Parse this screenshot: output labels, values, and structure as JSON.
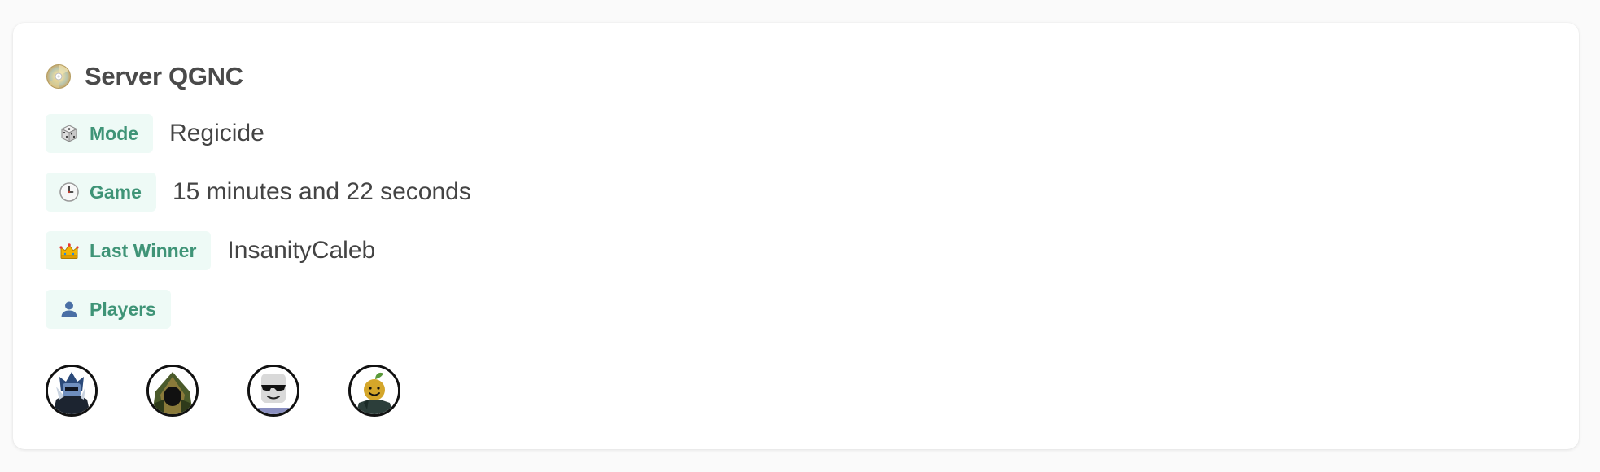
{
  "server": {
    "title": "Server QGNC",
    "icon": "disc-icon"
  },
  "fields": [
    {
      "label": "Mode",
      "icon": "die-icon",
      "value": "Regicide"
    },
    {
      "label": "Game",
      "icon": "clock-icon",
      "value": "15 minutes and 22 seconds"
    },
    {
      "label": "Last Winner",
      "icon": "crown-icon",
      "value": "InsanityCaleb"
    },
    {
      "label": "Players",
      "icon": "person-icon"
    }
  ],
  "players": [
    {
      "avatar": "player-avatar-knight"
    },
    {
      "avatar": "player-avatar-hooded"
    },
    {
      "avatar": "player-avatar-sunglasses"
    },
    {
      "avatar": "player-avatar-sprout"
    }
  ],
  "colors": {
    "tag_background": "#eefaf6",
    "tag_text": "#3f9477",
    "title_text": "#4a4a4a",
    "value_text": "#444444"
  }
}
